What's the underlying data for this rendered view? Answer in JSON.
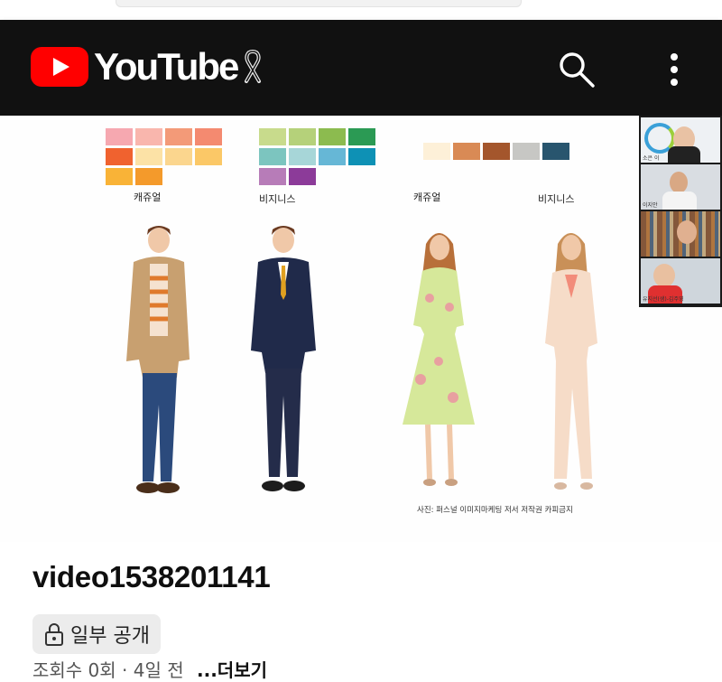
{
  "header": {
    "logo_text": "YouTube",
    "icons": [
      "youtube-logo-icon",
      "ribbon-icon",
      "search-icon",
      "more-vert-icon"
    ],
    "background": "#111111",
    "brand_red": "#ff0000"
  },
  "video": {
    "palettes": {
      "group1": [
        "#f6a8b0",
        "#f9b6ad",
        "#f39a78",
        "#f48a70",
        "#f0622f",
        "#fce2a6",
        "#fbd68e",
        "#fbc867",
        "#f9b337",
        "#f49a2b"
      ],
      "group2": [
        "#c8db8c",
        "#b5d17a",
        "#8cbb4f",
        "#2b9a54",
        "#7cc5bf",
        "#a7d6d8",
        "#66b7d6",
        "#0e91b5",
        "#b77cb8",
        "#8c3b99"
      ],
      "group3": [
        "#fdf0d8",
        "#d98a55",
        "#a4562c",
        "#c7c7c4",
        "#28556e"
      ]
    },
    "labels": [
      "캐쥬얼",
      "비지니스",
      "캐쥬얼",
      "비지니스"
    ],
    "caption": "사진: 퍼스널 이미지마케팅 저서 저작권 카피금지",
    "participants": [
      "소은 이",
      "이지안",
      "",
      "유지선(샘)-김주영"
    ]
  },
  "title": "video1538201141",
  "badge": {
    "icon": "lock-icon",
    "label": "일부 공개"
  },
  "meta": {
    "views": "조회수 0회 · 4일 전",
    "more": "...더보기"
  }
}
